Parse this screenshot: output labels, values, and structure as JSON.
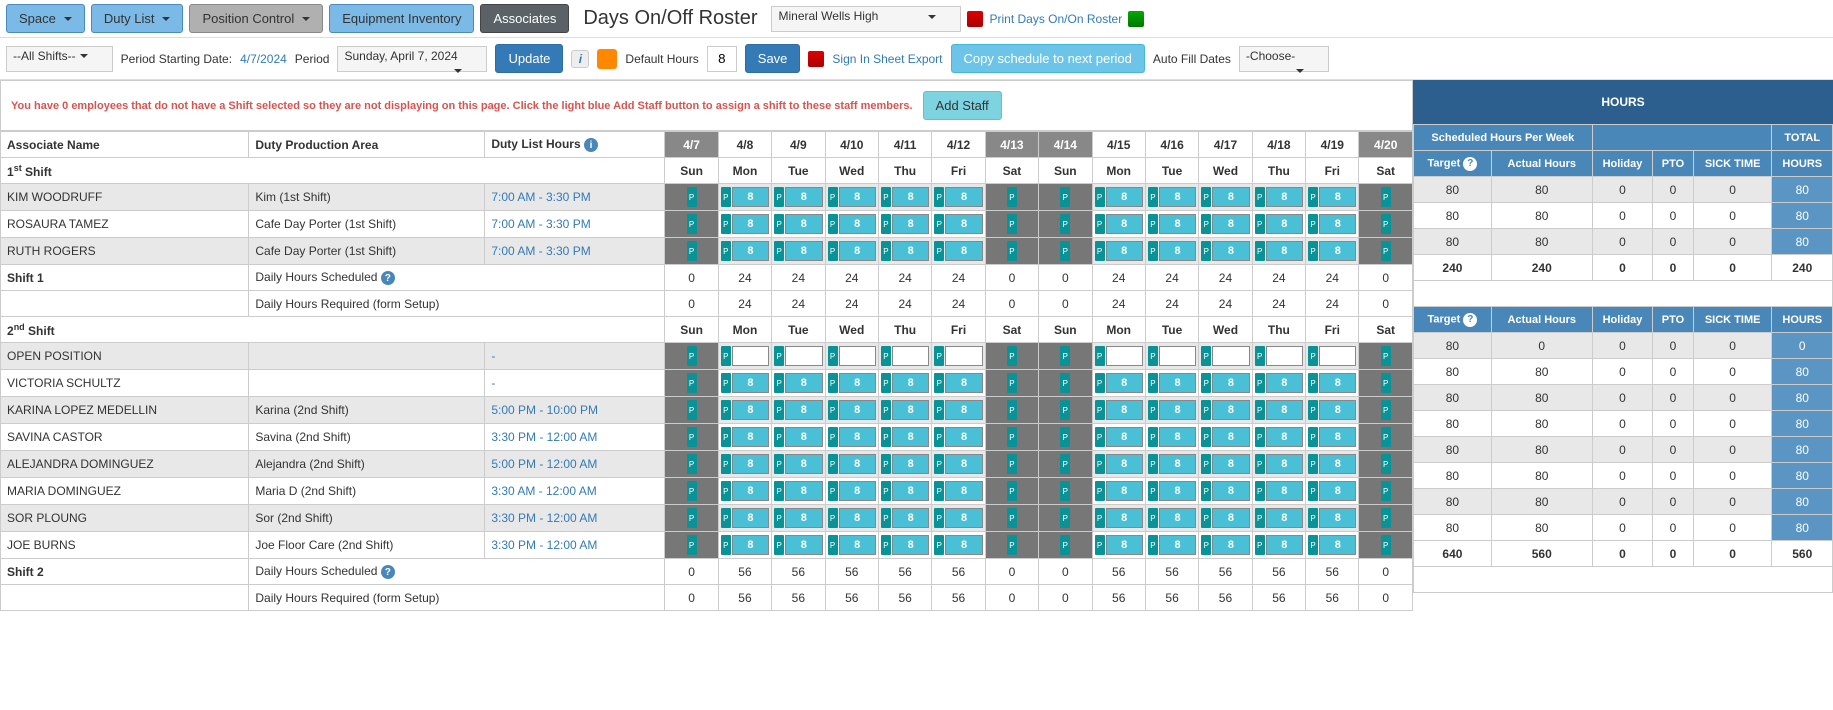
{
  "toolbar": {
    "space": "Space",
    "duty_list": "Duty List",
    "position_control": "Position Control",
    "equipment_inventory": "Equipment Inventory",
    "associates": "Associates",
    "title": "Days On/Off Roster",
    "location": "Mineral Wells High",
    "print": "Print Days On/On Roster"
  },
  "toolbar2": {
    "shifts": "--All Shifts--",
    "period_start_lbl": "Period Starting Date:",
    "period_start": "4/7/2024",
    "period_lbl": "Period",
    "period": "Sunday, April 7, 2024",
    "update": "Update",
    "default_hours_lbl": "Default Hours",
    "default_hours": "8",
    "save": "Save",
    "signin": "Sign In Sheet Export",
    "copy": "Copy schedule to next period",
    "autofill_lbl": "Auto Fill Dates",
    "autofill": "-Choose-"
  },
  "alert": {
    "text": "You have 0 employees that do not have a Shift selected so they are not displaying on this page. Click the light blue Add Staff button to assign a shift to these staff members.",
    "btn": "Add Staff"
  },
  "headers": {
    "name": "Associate Name",
    "area": "Duty Production Area",
    "hours": "Duty List Hours",
    "dates": [
      "4/7",
      "4/8",
      "4/9",
      "4/10",
      "4/11",
      "4/12",
      "4/13",
      "4/14",
      "4/15",
      "4/16",
      "4/17",
      "4/18",
      "4/19",
      "4/20"
    ],
    "days": [
      "Sun",
      "Mon",
      "Tue",
      "Wed",
      "Thu",
      "Fri",
      "Sat",
      "Sun",
      "Mon",
      "Tue",
      "Wed",
      "Thu",
      "Fri",
      "Sat"
    ],
    "off": [
      true,
      false,
      false,
      false,
      false,
      false,
      true,
      true,
      false,
      false,
      false,
      false,
      false,
      true
    ]
  },
  "right": {
    "hours": "HOURS",
    "scheduled": "Scheduled Hours Per Week",
    "total": "TOTAL",
    "cols": [
      "Target",
      "Actual Hours",
      "Holiday",
      "PTO",
      "SICK TIME",
      "HOURS"
    ]
  },
  "shifts": [
    {
      "label": "1<sup>st</sup> Shift",
      "rows": [
        {
          "name": "KIM WOODRUFF",
          "area": "Kim (1st Shift)",
          "hours": "7:00 AM - 3:30 PM",
          "cls": "row-gray",
          "days": [
            "",
            "8",
            "8",
            "8",
            "8",
            "8",
            "",
            "",
            "8",
            "8",
            "8",
            "8",
            "8",
            ""
          ],
          "r": [
            "80",
            "80",
            "0",
            "0",
            "0",
            "80"
          ]
        },
        {
          "name": "ROSAURA TAMEZ",
          "area": "Cafe Day Porter (1st Shift)",
          "hours": "7:00 AM - 3:30 PM",
          "cls": "row-white",
          "days": [
            "",
            "8",
            "8",
            "8",
            "8",
            "8",
            "",
            "",
            "8",
            "8",
            "8",
            "8",
            "8",
            ""
          ],
          "r": [
            "80",
            "80",
            "0",
            "0",
            "0",
            "80"
          ]
        },
        {
          "name": "RUTH ROGERS",
          "area": "Cafe Day Porter (1st Shift)",
          "hours": "7:00 AM - 3:30 PM",
          "cls": "row-gray",
          "days": [
            "",
            "8",
            "8",
            "8",
            "8",
            "8",
            "",
            "",
            "8",
            "8",
            "8",
            "8",
            "8",
            ""
          ],
          "r": [
            "80",
            "80",
            "0",
            "0",
            "0",
            "80"
          ]
        }
      ],
      "totals": {
        "label": "Shift 1",
        "sched_lbl": "Daily Hours Scheduled",
        "sched": [
          "0",
          "24",
          "24",
          "24",
          "24",
          "24",
          "0",
          "0",
          "24",
          "24",
          "24",
          "24",
          "24",
          "0"
        ],
        "req_lbl": "Daily Hours Required (form Setup)",
        "req": [
          "0",
          "24",
          "24",
          "24",
          "24",
          "24",
          "0",
          "0",
          "24",
          "24",
          "24",
          "24",
          "24",
          "0"
        ],
        "r": [
          "240",
          "240",
          "0",
          "0",
          "0",
          "240"
        ]
      }
    },
    {
      "label": "2<sup>nd</sup> Shift",
      "rows": [
        {
          "name": "OPEN POSITION",
          "area": "",
          "hours": "-",
          "cls": "row-gray",
          "days": [
            "",
            "",
            "",
            "",
            "",
            "",
            "",
            "",
            "",
            "",
            "",
            "",
            "",
            ""
          ],
          "r": [
            "80",
            "0",
            "0",
            "0",
            "0",
            "0"
          ]
        },
        {
          "name": "VICTORIA SCHULTZ",
          "area": "",
          "hours": "-",
          "cls": "row-white",
          "days": [
            "",
            "8",
            "8",
            "8",
            "8",
            "8",
            "",
            "",
            "8",
            "8",
            "8",
            "8",
            "8",
            ""
          ],
          "r": [
            "80",
            "80",
            "0",
            "0",
            "0",
            "80"
          ]
        },
        {
          "name": "KARINA LOPEZ MEDELLIN",
          "area": "Karina (2nd Shift)",
          "hours": "5:00 PM - 10:00 PM",
          "cls": "row-gray",
          "days": [
            "",
            "8",
            "8",
            "8",
            "8",
            "8",
            "",
            "",
            "8",
            "8",
            "8",
            "8",
            "8",
            ""
          ],
          "r": [
            "80",
            "80",
            "0",
            "0",
            "0",
            "80"
          ]
        },
        {
          "name": "SAVINA CASTOR",
          "area": "Savina (2nd Shift)",
          "hours": "3:30 PM - 12:00 AM",
          "cls": "row-white",
          "days": [
            "",
            "8",
            "8",
            "8",
            "8",
            "8",
            "",
            "",
            "8",
            "8",
            "8",
            "8",
            "8",
            ""
          ],
          "r": [
            "80",
            "80",
            "0",
            "0",
            "0",
            "80"
          ]
        },
        {
          "name": "ALEJANDRA DOMINGUEZ",
          "area": "Alejandra (2nd Shift)",
          "hours": "5:00 PM - 12:00 AM",
          "cls": "row-gray",
          "days": [
            "",
            "8",
            "8",
            "8",
            "8",
            "8",
            "",
            "",
            "8",
            "8",
            "8",
            "8",
            "8",
            ""
          ],
          "r": [
            "80",
            "80",
            "0",
            "0",
            "0",
            "80"
          ]
        },
        {
          "name": "MARIA DOMINGUEZ",
          "area": "Maria D (2nd Shift)",
          "hours": "3:30 AM - 12:00 AM",
          "cls": "row-white",
          "days": [
            "",
            "8",
            "8",
            "8",
            "8",
            "8",
            "",
            "",
            "8",
            "8",
            "8",
            "8",
            "8",
            ""
          ],
          "r": [
            "80",
            "80",
            "0",
            "0",
            "0",
            "80"
          ]
        },
        {
          "name": "SOR PLOUNG",
          "area": "Sor (2nd Shift)",
          "hours": "3:30 PM - 12:00 AM",
          "cls": "row-gray",
          "days": [
            "",
            "8",
            "8",
            "8",
            "8",
            "8",
            "",
            "",
            "8",
            "8",
            "8",
            "8",
            "8",
            ""
          ],
          "r": [
            "80",
            "80",
            "0",
            "0",
            "0",
            "80"
          ]
        },
        {
          "name": "JOE BURNS",
          "area": "Joe Floor Care (2nd Shift)",
          "hours": "3:30 PM - 12:00 AM",
          "cls": "row-white",
          "days": [
            "",
            "8",
            "8",
            "8",
            "8",
            "8",
            "",
            "",
            "8",
            "8",
            "8",
            "8",
            "8",
            ""
          ],
          "r": [
            "80",
            "80",
            "0",
            "0",
            "0",
            "80"
          ]
        }
      ],
      "totals": {
        "label": "Shift 2",
        "sched_lbl": "Daily Hours Scheduled",
        "sched": [
          "0",
          "56",
          "56",
          "56",
          "56",
          "56",
          "0",
          "0",
          "56",
          "56",
          "56",
          "56",
          "56",
          "0"
        ],
        "req_lbl": "Daily Hours Required (form Setup)",
        "req": [
          "0",
          "56",
          "56",
          "56",
          "56",
          "56",
          "0",
          "0",
          "56",
          "56",
          "56",
          "56",
          "56",
          "0"
        ],
        "r": [
          "640",
          "560",
          "0",
          "0",
          "0",
          "560"
        ]
      }
    }
  ]
}
